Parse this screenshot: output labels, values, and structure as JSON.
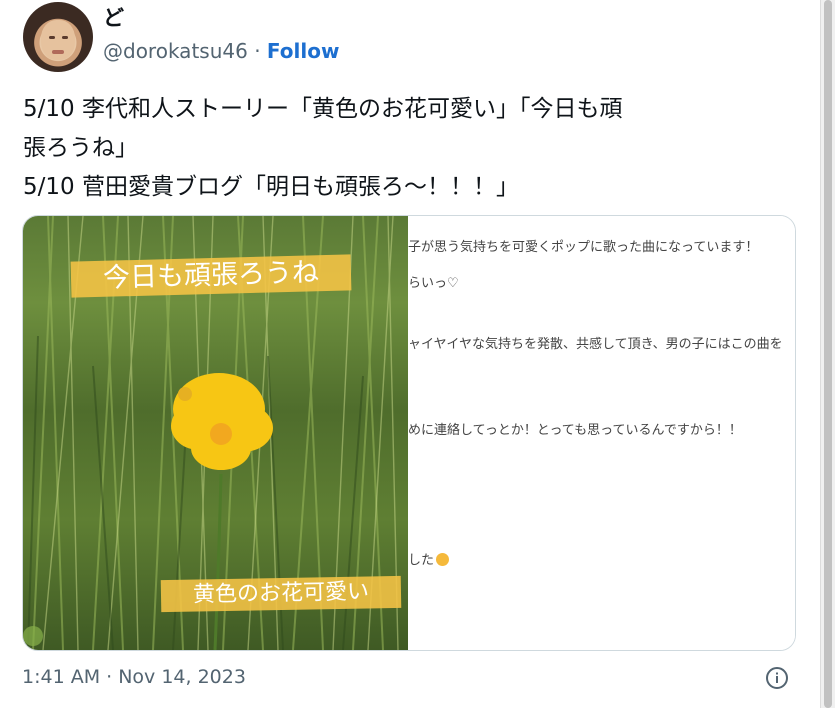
{
  "author": {
    "display_name": "ど",
    "handle": "@dorokatsu46",
    "separator": "·",
    "follow_label": "Follow"
  },
  "tweet": {
    "lines": [
      "5/10 李代和人ストーリー「黄色のお花可愛い」「今日も頑",
      "張ろうね」",
      "5/10 菅田愛貴ブログ「明日も頑張ろ～！！！」"
    ],
    "timestamp": "1:41 AM · Nov 14, 2023"
  },
  "media": {
    "photo": {
      "caption_top": "今日も頑張ろうね",
      "caption_bottom": "黄色のお花可愛い"
    },
    "blog": {
      "lines": [
        "子が思う気持ちを可愛くポップに歌った曲になっています！",
        "らいっ♡",
        "ャイヤイヤな気持ちを発散、共感して頂き、男の子にはこの曲を",
        "めに連絡してっとか！とっても思っているんですから！！",
        "した"
      ]
    }
  },
  "colors": {
    "link_blue": "#1d6fd0",
    "secondary_text": "#536471",
    "tape_yellow": "#f6c446",
    "flower_yellow": "#f7c614"
  },
  "icons": {
    "info": "info-circle-icon",
    "emoji": "smiling-face-emoji"
  }
}
